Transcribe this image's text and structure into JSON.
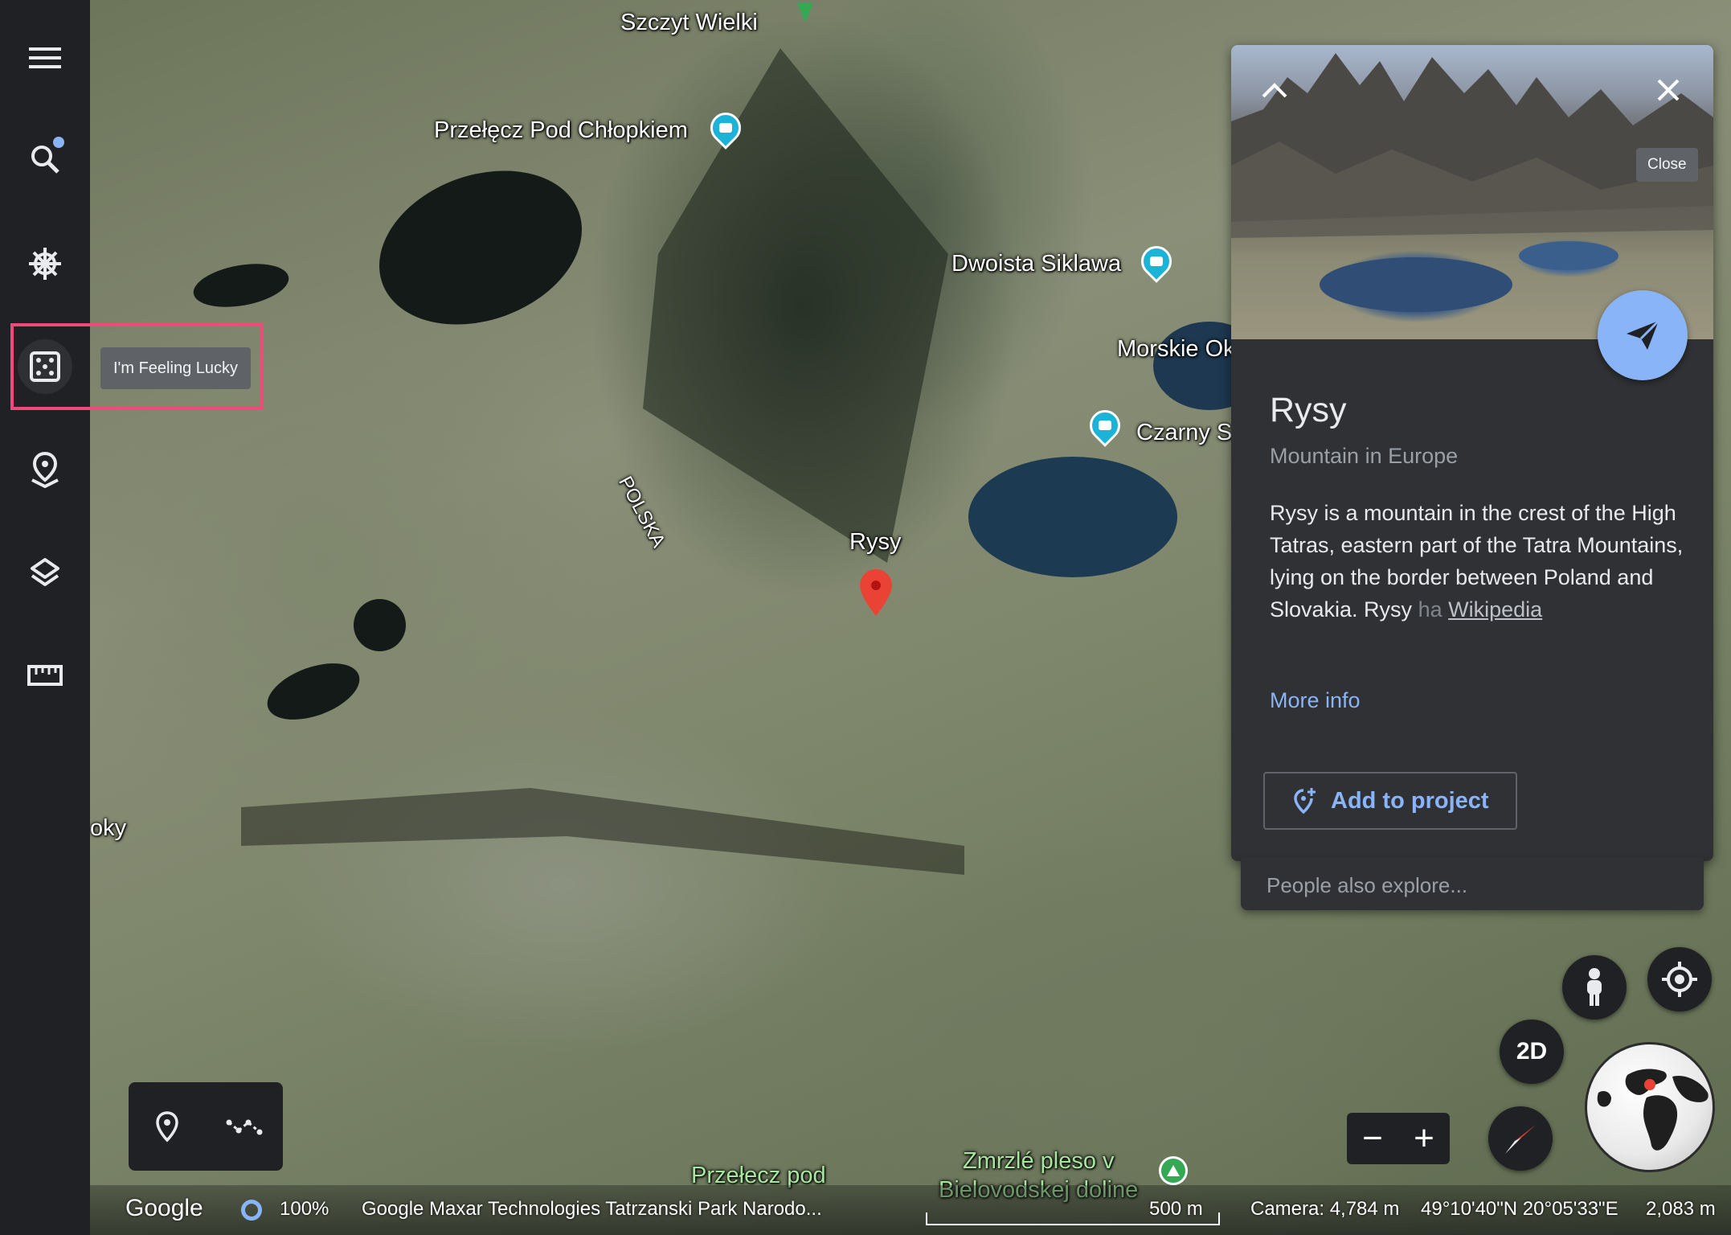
{
  "map": {
    "labels": {
      "szczyt": "Szczyt Wielki",
      "przelecz_chlopkiem": "Przełęcz Pod Chłopkiem",
      "dwoista": "Dwoista Siklawa",
      "morskie": "Morskie Ok",
      "czarny": "Czarny S",
      "rysy": "Rysy",
      "polska": "POLSKA",
      "oky": "oky",
      "przelecz_pod": "Przełecz pod",
      "zmrzle": "Zmrzlé pleso v",
      "bielovodskej": "Bielovodskej doline"
    }
  },
  "sidebar": {
    "items": [
      {
        "name": "menu",
        "icon": "menu-icon"
      },
      {
        "name": "search",
        "icon": "search-icon",
        "badge": true
      },
      {
        "name": "voyager",
        "icon": "ship-wheel-icon"
      },
      {
        "name": "feeling-lucky",
        "icon": "dice-icon",
        "active": true
      },
      {
        "name": "projects",
        "icon": "location-pin-icon"
      },
      {
        "name": "map-style",
        "icon": "layers-icon"
      },
      {
        "name": "measure",
        "icon": "ruler-icon"
      }
    ],
    "tooltip": "I'm Feeling Lucky",
    "highlight_color": "#f0497a"
  },
  "info_panel": {
    "title": "Rysy",
    "subtitle": "Mountain in Europe",
    "description": "Rysy is a mountain in the crest of the High Tatras, eastern part of the Tatra Mountains, lying on the border between Poland and Slovakia. Rysy",
    "description_fade": " ha",
    "wikipedia": "Wikipedia",
    "more_info": "More info",
    "add_to_project": "Add to project",
    "close_tooltip": "Close",
    "people_also_explore": "People also explore..."
  },
  "controls": {
    "btn_2d": "2D",
    "zoom_out": "−",
    "zoom_in": "+"
  },
  "status_bar": {
    "logo": "Google",
    "load_percent": "100%",
    "attribution": "Google  Maxar Technologies  Tatrzanski Park Narodo...",
    "scale": "500 m",
    "camera": "Camera: 4,784 m",
    "coordinates": "49°10'40\"N 20°05'33\"E",
    "elevation": "2,083 m"
  },
  "colors": {
    "accent": "#8ab4f8",
    "panel_bg": "#303134",
    "sidebar_bg": "#202124",
    "pin_red": "#ea4335"
  }
}
